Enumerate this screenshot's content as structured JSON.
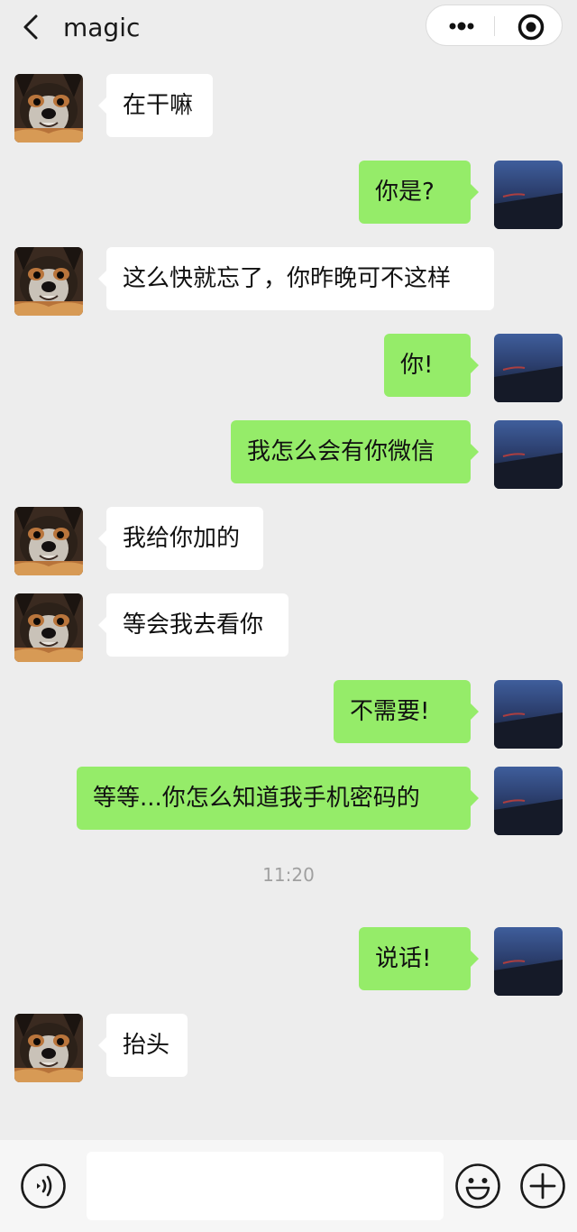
{
  "header": {
    "title": "magic",
    "back_icon": "chevron-left-icon",
    "more_icon": "more-dots-icon",
    "target_icon": "target-icon"
  },
  "messages": [
    {
      "side": "in",
      "text": "在干嘛"
    },
    {
      "side": "out",
      "text": "你是?"
    },
    {
      "side": "in",
      "text": "这么快就忘了，你昨晚可不这样"
    },
    {
      "side": "out",
      "text": "你!"
    },
    {
      "side": "out",
      "text": "我怎么会有你微信"
    },
    {
      "side": "in",
      "text": "我给你加的"
    },
    {
      "side": "in",
      "text": "等会我去看你"
    },
    {
      "side": "out",
      "text": "不需要!"
    },
    {
      "side": "out",
      "text": "等等...你怎么知道我手机密码的"
    },
    {
      "side": "out",
      "text": "说话!"
    },
    {
      "side": "in",
      "text": "抬头"
    }
  ],
  "timestamp": "11:20",
  "input_bar": {
    "text_value": "",
    "voice_icon": "voice-icon",
    "emoji_icon": "emoji-icon",
    "plus_icon": "plus-icon"
  },
  "colors": {
    "background": "#ededed",
    "bubble_out": "#95ec69",
    "bubble_in": "#ffffff"
  }
}
